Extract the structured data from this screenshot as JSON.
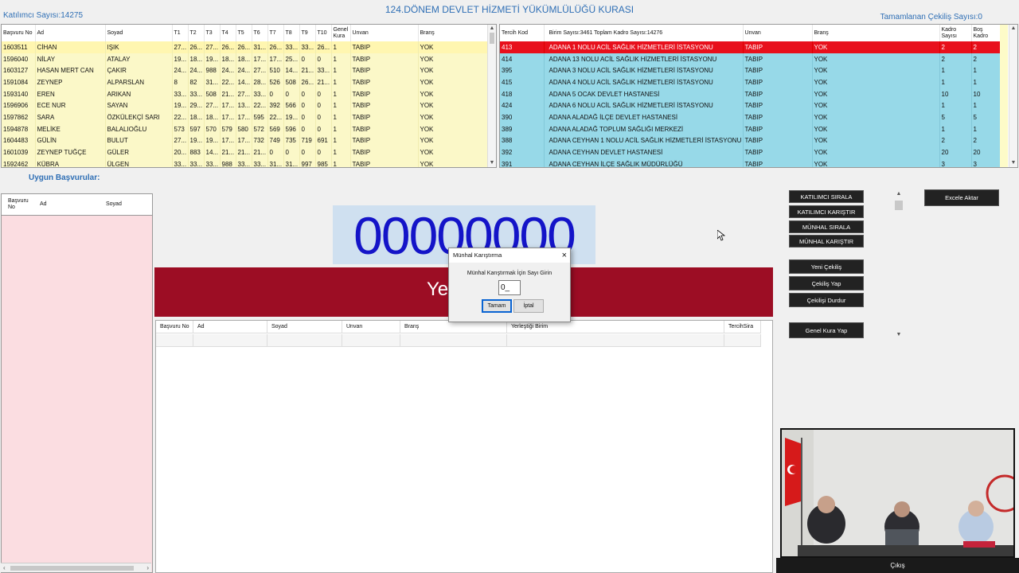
{
  "header": {
    "title": "124.DÖNEM DEVLET HİZMETİ YÜKÜMLÜLÜĞÜ KURASI",
    "participant_count": "Katılımcı Sayısı:14275",
    "completed_draws": "Tamamlanan Çekiliş Sayısı:0"
  },
  "participants_table": {
    "columns": [
      "Başvuru No",
      "Ad",
      "Soyad",
      "T1",
      "T2",
      "T3",
      "T4",
      "T5",
      "T6",
      "T7",
      "T8",
      "T9",
      "T10",
      "Genel Kura",
      "Unvan",
      "Branş"
    ],
    "rows": [
      [
        "1603511",
        "CİHAN",
        "IŞIK",
        "27...",
        "26...",
        "27...",
        "26...",
        "26...",
        "31...",
        "26...",
        "33...",
        "33...",
        "26...",
        "1",
        "TABIP",
        "YOK"
      ],
      [
        "1596040",
        "NİLAY",
        "ATALAY",
        "19...",
        "18...",
        "19...",
        "18...",
        "18...",
        "17...",
        "17...",
        "25...",
        "0",
        "0",
        "1",
        "TABIP",
        "YOK"
      ],
      [
        "1603127",
        "HASAN MERT CAN",
        "ÇAKIR",
        "24...",
        "24...",
        "988",
        "24...",
        "24...",
        "27...",
        "510",
        "14...",
        "21...",
        "33...",
        "1",
        "TABIP",
        "YOK"
      ],
      [
        "1591084",
        "ZEYNEP",
        "ALPARSLAN",
        "8",
        "82",
        "31...",
        "22...",
        "14...",
        "28...",
        "526",
        "508",
        "26...",
        "21...",
        "1",
        "TABIP",
        "YOK"
      ],
      [
        "1593140",
        "EREN",
        "ARIKAN",
        "33...",
        "33...",
        "508",
        "21...",
        "27...",
        "33...",
        "0",
        "0",
        "0",
        "0",
        "1",
        "TABIP",
        "YOK"
      ],
      [
        "1596906",
        "ECE NUR",
        "SAYAN",
        "19...",
        "29...",
        "27...",
        "17...",
        "13...",
        "22...",
        "392",
        "566",
        "0",
        "0",
        "1",
        "TABIP",
        "YOK"
      ],
      [
        "1597862",
        "SARA",
        "ÖZKÜLEKÇİ SARI",
        "22...",
        "18...",
        "18...",
        "17...",
        "17...",
        "595",
        "22...",
        "19...",
        "0",
        "0",
        "1",
        "TABIP",
        "YOK"
      ],
      [
        "1594878",
        "MELİKE",
        "BALALIOĞLU",
        "573",
        "597",
        "570",
        "579",
        "580",
        "572",
        "569",
        "596",
        "0",
        "0",
        "1",
        "TABIP",
        "YOK"
      ],
      [
        "1604483",
        "GÜLİN",
        "BULUT",
        "27...",
        "19...",
        "19...",
        "17...",
        "17...",
        "732",
        "749",
        "735",
        "719",
        "691",
        "1",
        "TABIP",
        "YOK"
      ],
      [
        "1601039",
        "ZEYNEP TUĞÇE",
        "GÜLER",
        "20...",
        "883",
        "14...",
        "21...",
        "21...",
        "21...",
        "0",
        "0",
        "0",
        "0",
        "1",
        "TABIP",
        "YOK"
      ],
      [
        "1592462",
        "KÜBRA",
        "ÜLGEN",
        "33...",
        "33...",
        "33...",
        "988",
        "33...",
        "33...",
        "31...",
        "31...",
        "997",
        "985",
        "1",
        "TABIP",
        "YOK"
      ]
    ]
  },
  "units_table": {
    "columns": [
      "Tercih Kod",
      "Birim Sayısı:3461 Toplam Kadro Sayısı:14276",
      "Unvan",
      "Branş",
      "Kadro Sayısı",
      "Boş Kadro"
    ],
    "rows": [
      [
        "413",
        "ADANA 1 NOLU ACİL SAĞLIK HİZMETLERİ İSTASYONU",
        "TABIP",
        "YOK",
        "2",
        "2"
      ],
      [
        "414",
        "ADANA 13 NOLU ACİL SAĞLIK HİZMETLERİ İSTASYONU",
        "TABIP",
        "YOK",
        "2",
        "2"
      ],
      [
        "395",
        "ADANA 3 NOLU ACİL SAĞLIK HİZMETLERİ İSTASYONU",
        "TABIP",
        "YOK",
        "1",
        "1"
      ],
      [
        "415",
        "ADANA 4 NOLU ACİL SAĞLIK HİZMETLERİ İSTASYONU",
        "TABIP",
        "YOK",
        "1",
        "1"
      ],
      [
        "418",
        "ADANA 5 OCAK DEVLET HASTANESİ",
        "TABIP",
        "YOK",
        "10",
        "10"
      ],
      [
        "424",
        "ADANA 6 NOLU ACİL SAĞLIK HİZMETLERİ İSTASYONU",
        "TABIP",
        "YOK",
        "1",
        "1"
      ],
      [
        "390",
        "ADANA ALADAĞ İLÇE DEVLET HASTANESİ",
        "TABIP",
        "YOK",
        "5",
        "5"
      ],
      [
        "389",
        "ADANA ALADAĞ TOPLUM SAĞLIĞI MERKEZİ",
        "TABIP",
        "YOK",
        "1",
        "1"
      ],
      [
        "388",
        "ADANA CEYHAN 1 NOLU ACİL SAĞLIK HİZMETLERİ İSTASYONU",
        "TABIP",
        "YOK",
        "2",
        "2"
      ],
      [
        "392",
        "ADANA CEYHAN DEVLET HASTANESİ",
        "TABIP",
        "YOK",
        "20",
        "20"
      ],
      [
        "391",
        "ADANA CEYHAN İLÇE SAĞLIK MÜDÜRLÜĞÜ",
        "TABIP",
        "YOK",
        "3",
        "3"
      ]
    ]
  },
  "eligible": {
    "title": "Uygun Başvurular:",
    "columns": [
      "Başvuru No",
      "Ad",
      "Soyad"
    ]
  },
  "draw": {
    "number": "00000000",
    "band_text": "Ye"
  },
  "results_table": {
    "columns": [
      "Başvuru No",
      "Ad",
      "Soyad",
      "Unvan",
      "Branş",
      "Yerleştiği Birim",
      "TercihSira"
    ]
  },
  "dialog": {
    "title": "Münhal Karıştırma",
    "message": "Münhal Karıştırmak İçin Sayı Girin",
    "value": "0_",
    "ok": "Tamam",
    "cancel": "İptal",
    "close": "×"
  },
  "controls": {
    "participant_sort": "KATILIMCI SIRALA",
    "participant_shuffle": "KATILIMCI KARIŞTIR",
    "vacancy_sort": "MÜNHAL SIRALA",
    "vacancy_shuffle": "MÜNHAL KARIŞTIR",
    "new_draw": "Yeni Çekiliş",
    "do_draw": "Çekiliş Yap",
    "stop_draw": "Çekilişi Durdur",
    "general_draw": "Genel Kura Yap",
    "export_excel": "Excele Aktar",
    "exit": "Çıkış"
  },
  "icons": {
    "scroll_up": "scroll-up-icon",
    "scroll_down": "scroll-down-icon",
    "close": "close-icon",
    "cursor": "mouse-pointer-icon"
  },
  "colors": {
    "accent_blue": "#2f6fb5",
    "participant_row": "#fbf8c8",
    "unit_row": "#97d9e8",
    "selected_row": "#e8101c",
    "band": "#9c0d24",
    "big_number": "#1414c8",
    "eligible_bg": "#fbdde1"
  }
}
